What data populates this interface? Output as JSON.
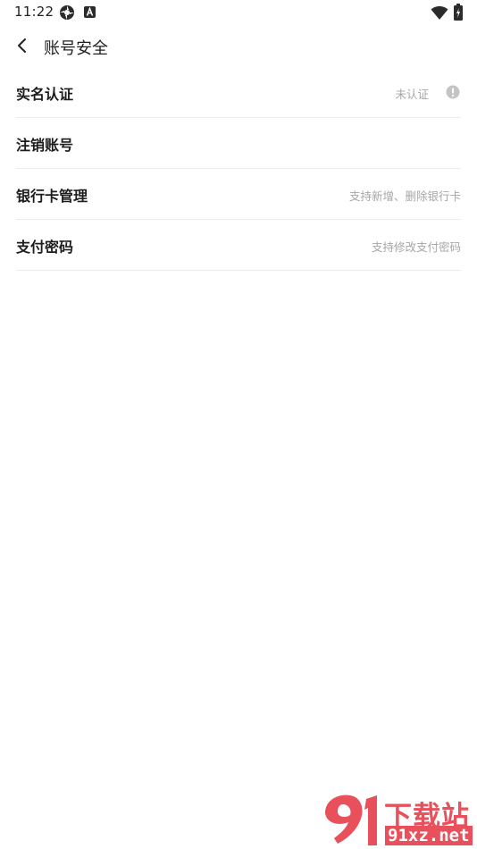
{
  "status_bar": {
    "time": "11:22"
  },
  "header": {
    "title": "账号安全"
  },
  "settings": {
    "items": [
      {
        "label": "实名认证",
        "hint": "未认证",
        "icon": "info-circle-icon"
      },
      {
        "label": "注销账号",
        "hint": ""
      },
      {
        "label": "银行卡管理",
        "hint": "支持新增、删除银行卡"
      },
      {
        "label": "支付密码",
        "hint": "支持修改支付密码"
      }
    ]
  },
  "watermark": {
    "brand_mark": "91",
    "brand_text": "下载站",
    "domain": "91xz.net"
  },
  "colors": {
    "background": "#ffffff",
    "divider": "#ececec",
    "hint_text": "#a6a6a6",
    "watermark_red": "#e8505b"
  }
}
